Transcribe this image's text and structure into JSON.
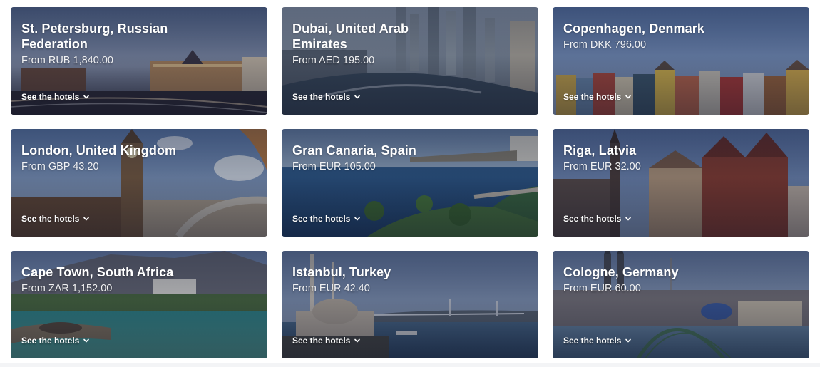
{
  "see_label": "See the hotels",
  "cards": [
    {
      "city": "St. Petersburg, Russian Federation",
      "price": "From RUB 1,840.00"
    },
    {
      "city": "Dubai, United Arab Emirates",
      "price": "From AED 195.00"
    },
    {
      "city": "Copenhagen, Denmark",
      "price": "From DKK 796.00"
    },
    {
      "city": "London, United Kingdom",
      "price": "From GBP 43.20"
    },
    {
      "city": "Gran Canaria, Spain",
      "price": "From EUR 105.00"
    },
    {
      "city": "Riga, Latvia",
      "price": "From EUR 32.00"
    },
    {
      "city": "Cape Town, South Africa",
      "price": "From ZAR 1,152.00"
    },
    {
      "city": "Istanbul, Turkey",
      "price": "From EUR 42.40"
    },
    {
      "city": "Cologne, Germany",
      "price": "From EUR 60.00"
    }
  ]
}
